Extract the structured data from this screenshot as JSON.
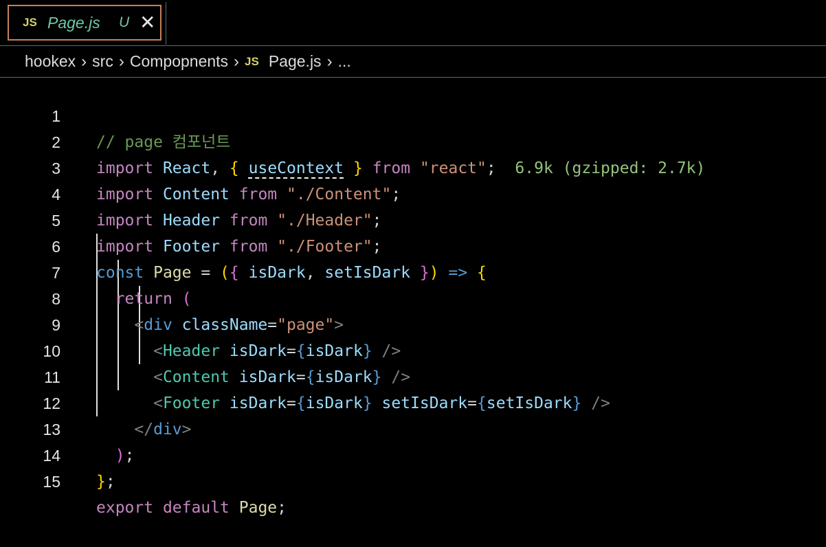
{
  "tab": {
    "badge": "JS",
    "filename": "Page.js",
    "status": "U",
    "close": "✕"
  },
  "breadcrumb": {
    "items": [
      "hookex",
      "src",
      "Compopnents"
    ],
    "file_badge": "JS",
    "file": "Page.js",
    "more": "..."
  },
  "editor": {
    "line_numbers": [
      "1",
      "2",
      "3",
      "4",
      "5",
      "6",
      "7",
      "8",
      "9",
      "10",
      "11",
      "12",
      "13",
      "14",
      "15"
    ],
    "line1_comment": "// page 컴포넌트",
    "line2": {
      "kw": "import",
      "name": "React",
      "hook": "useContext",
      "from": "from",
      "src": "\"react\"",
      "size_hint": "6.9k (gzipped: 2.7k)"
    },
    "line3": {
      "kw": "import",
      "name": "Content",
      "from": "from",
      "src": "\"./Content\""
    },
    "line4": {
      "kw": "import",
      "name": "Header",
      "from": "from",
      "src": "\"./Header\""
    },
    "line5": {
      "kw": "import",
      "name": "Footer",
      "from": "from",
      "src": "\"./Footer\""
    },
    "line6": {
      "kw": "const",
      "name": "Page",
      "p1": "isDark",
      "p2": "setIsDark"
    },
    "line7": {
      "kw": "return"
    },
    "line8": {
      "tag": "div",
      "attr": "className",
      "val": "\"page\""
    },
    "line9": {
      "tag": "Header",
      "attr": "isDark",
      "val": "isDark"
    },
    "line10": {
      "tag": "Content",
      "attr": "isDark",
      "val": "isDark"
    },
    "line11": {
      "tag": "Footer",
      "attr": "isDark",
      "val": "isDark",
      "attr2": "setIsDark",
      "val2": "setIsDark"
    },
    "line12": {
      "tag": "div"
    },
    "line15": {
      "kw": "export",
      "kw2": "default",
      "name": "Page"
    }
  }
}
